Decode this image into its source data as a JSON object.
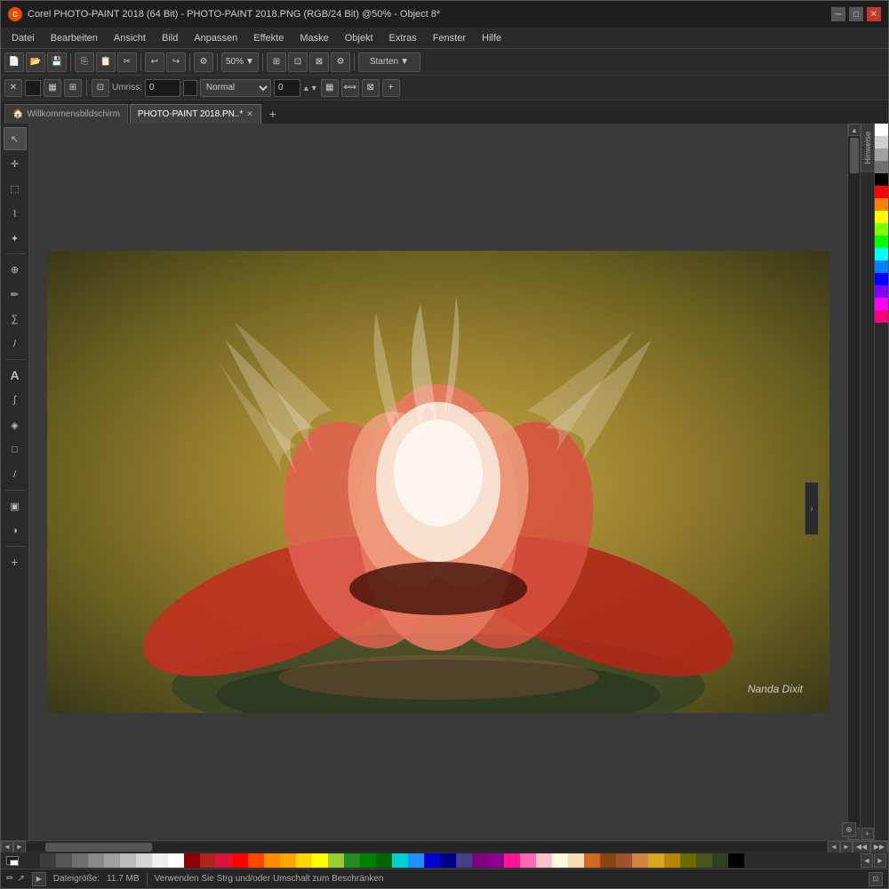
{
  "window": {
    "title": "Corel PHOTO-PAINT 2018 (64 Bit) - PHOTO-PAINT 2018.PNG (RGB/24 Bit) @50% - Object 8*",
    "app_name": "Corel PHOTO-PAINT 2018 (64 Bit)",
    "file_info": "PHOTO-PAINT 2018.PNG (RGB/24 Bit) @50% - Object 8*"
  },
  "menu": {
    "items": [
      "Datei",
      "Bearbeiten",
      "Ansicht",
      "Bild",
      "Anpassen",
      "Effekte",
      "Maske",
      "Objekt",
      "Extras",
      "Fenster",
      "Hilfe"
    ]
  },
  "toolbar1": {
    "zoom_value": "50%",
    "start_btn": "Starten"
  },
  "toolbar2": {
    "outline_label": "Umriss:",
    "outline_value": "0",
    "mode_label": "Normal",
    "feather_value": "0"
  },
  "tabs": {
    "home": "Willkommensbildschirm",
    "file": "PHOTO-PAINT 2018.PN..*",
    "add_tab": "+"
  },
  "tools": [
    {
      "name": "select",
      "icon": "↖",
      "label": "Selection Tool"
    },
    {
      "name": "move",
      "icon": "✛",
      "label": "Move Tool"
    },
    {
      "name": "rect-select",
      "icon": "⬚",
      "label": "Rectangle Selection"
    },
    {
      "name": "lasso",
      "icon": "⌇",
      "label": "Lasso Tool"
    },
    {
      "name": "magic-wand",
      "icon": "✦",
      "label": "Magic Wand"
    },
    {
      "name": "zoom",
      "icon": "🔍",
      "label": "Zoom Tool"
    },
    {
      "name": "eyedropper",
      "icon": "✏",
      "label": "Eyedropper"
    },
    {
      "name": "path",
      "icon": "∑",
      "label": "Path Tool"
    },
    {
      "name": "healing",
      "icon": "/",
      "label": "Healing Tool"
    },
    {
      "name": "text",
      "icon": "A",
      "label": "Text Tool"
    },
    {
      "name": "brush",
      "icon": "∫",
      "label": "Brush Tool"
    },
    {
      "name": "paint-bucket",
      "icon": "◈",
      "label": "Paint Bucket"
    },
    {
      "name": "rectangle",
      "icon": "□",
      "label": "Rectangle Tool"
    },
    {
      "name": "knife",
      "icon": "/",
      "label": "Knife Tool"
    },
    {
      "name": "gradient",
      "icon": "▣",
      "label": "Gradient Tool"
    },
    {
      "name": "black-white",
      "icon": "◑",
      "label": "Black White"
    }
  ],
  "canvas": {
    "watermark": "Nanda Dixit",
    "image_title": "Lotus Flower"
  },
  "color_palette_vertical": [
    "#ffffff",
    "#e0e0e0",
    "#c0c0c0",
    "#a0a0a0",
    "#808080",
    "#600000",
    "#800000",
    "#a00000",
    "#c00000",
    "#e00000",
    "#ff0000",
    "#ff4000",
    "#ff8000",
    "#ffbf00",
    "#ffff00",
    "#80ff00",
    "#00ff00",
    "#00ff80",
    "#00ffff",
    "#0080ff",
    "#0000ff",
    "#8000ff",
    "#ff00ff",
    "#ff0080",
    "#000000"
  ],
  "color_palette_bottom": [
    "#1a1a1a",
    "#2a2a2a",
    "#3d3d3d",
    "#555555",
    "#6e6e6e",
    "#888888",
    "#a0a0a0",
    "#bbbbbb",
    "#d4d4d4",
    "#eeeeee",
    "#ffffff",
    "#8b0000",
    "#b22222",
    "#dc143c",
    "#ff0000",
    "#ff4500",
    "#ff8c00",
    "#ffa500",
    "#ffd700",
    "#ffff00",
    "#9acd32",
    "#228b22",
    "#008000",
    "#006400",
    "#00ced1",
    "#1e90ff",
    "#0000cd",
    "#00008b",
    "#483d8b",
    "#800080",
    "#8b008b",
    "#ff1493",
    "#ff69b4",
    "#ffc0cb",
    "#fff8dc",
    "#f5deb3",
    "#d2691e",
    "#8b4513",
    "#a0522d",
    "#cd853f",
    "#daa520",
    "#b8860b",
    "#6b6b00",
    "#4b5320",
    "#2e4020",
    "#1a2a10",
    "#0a1508",
    "#000000"
  ],
  "status_bar": {
    "file_size_label": "Dateigröße:",
    "file_size_value": "11.7 MB",
    "hint_text": "Verwenden Sie Strg und/oder Umschalt zum Beschränken"
  }
}
